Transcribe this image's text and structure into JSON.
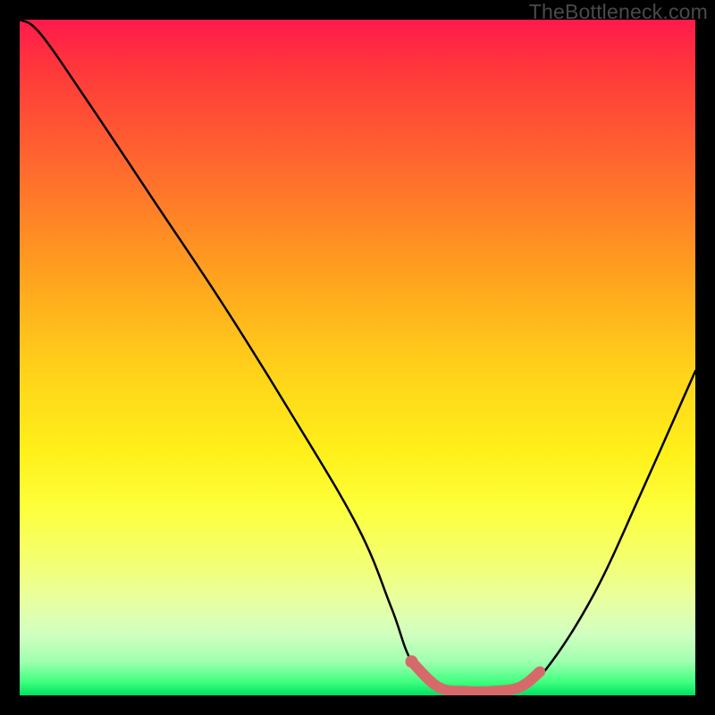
{
  "watermark": "TheBottleneck.com",
  "chart_data": {
    "type": "line",
    "title": "",
    "xlabel": "",
    "ylabel": "",
    "xlim": [
      0,
      100
    ],
    "ylim": [
      0,
      100
    ],
    "series": [
      {
        "name": "bottleneck-curve",
        "x": [
          0,
          3,
          10,
          20,
          30,
          40,
          50,
          55,
          58,
          62,
          66,
          70,
          74,
          78,
          85,
          92,
          100
        ],
        "y": [
          100,
          98,
          88,
          73,
          58,
          42,
          25,
          13,
          5,
          1,
          0.5,
          0.5,
          1,
          4,
          15,
          30,
          48
        ]
      }
    ],
    "highlight_segment": {
      "name": "optimal-range",
      "x": [
        58,
        62,
        66,
        70,
        74,
        77
      ],
      "y": [
        5,
        1.2,
        0.6,
        0.6,
        1.2,
        3.5
      ]
    }
  }
}
